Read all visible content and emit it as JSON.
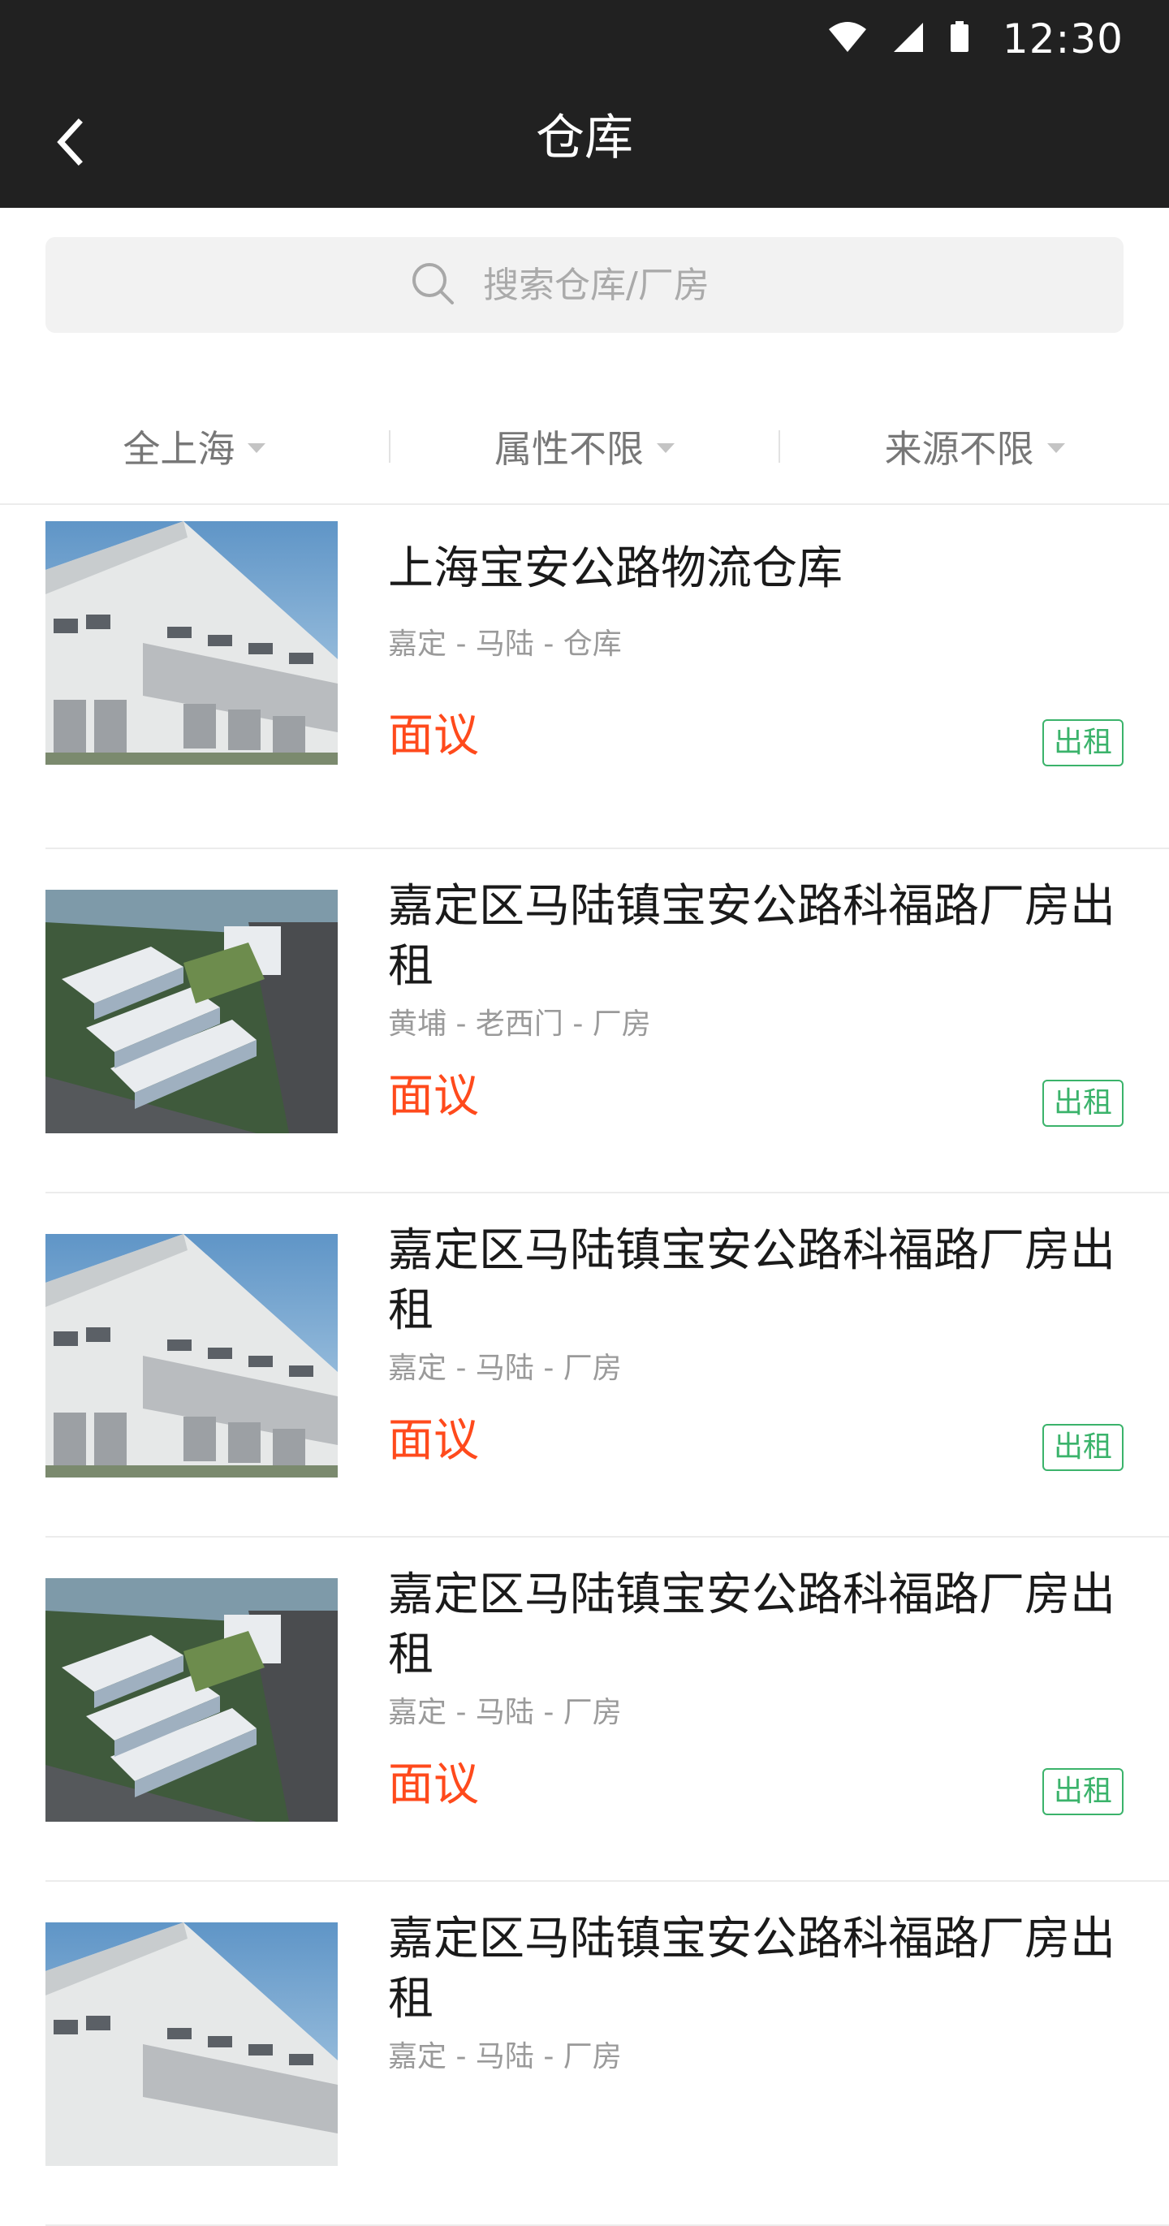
{
  "status_bar": {
    "time": "12:30",
    "icons": [
      "wifi-icon",
      "cell-signal-icon",
      "battery-icon"
    ]
  },
  "app_bar": {
    "title": "仓库",
    "back_icon": "chevron-left-icon"
  },
  "search": {
    "placeholder": "搜索仓库/厂房",
    "value": "",
    "icon": "search-icon"
  },
  "filters": [
    {
      "label": "全上海"
    },
    {
      "label": "属性不限"
    },
    {
      "label": "来源不限"
    }
  ],
  "colors": {
    "header_bg": "#212121",
    "price": "#ff4a1c",
    "tag": "#3bb36b",
    "meta_text": "#9a9a9a"
  },
  "listings": [
    {
      "title": "上海宝安公路物流仓库",
      "location": "嘉定 - 马陆 - 仓库",
      "price": "面议",
      "tag": "出租",
      "image": "warehouse-photo"
    },
    {
      "title": "嘉定区马陆镇宝安公路科福路厂房出租",
      "location": "黄埔 - 老西门 - 厂房",
      "price": "面议",
      "tag": "出租",
      "image": "industrial-park-aerial-photo"
    },
    {
      "title": "嘉定区马陆镇宝安公路科福路厂房出租",
      "location": "嘉定 - 马陆 - 厂房",
      "price": "面议",
      "tag": "出租",
      "image": "warehouse-photo"
    },
    {
      "title": "嘉定区马陆镇宝安公路科福路厂房出租",
      "location": "嘉定 - 马陆 - 厂房",
      "price": "面议",
      "tag": "出租",
      "image": "industrial-park-aerial-photo"
    },
    {
      "title": "嘉定区马陆镇宝安公路科福路厂房出租",
      "location": "嘉定 - 马陆 - 厂房",
      "price": "",
      "tag": "",
      "image": "warehouse-photo"
    }
  ]
}
